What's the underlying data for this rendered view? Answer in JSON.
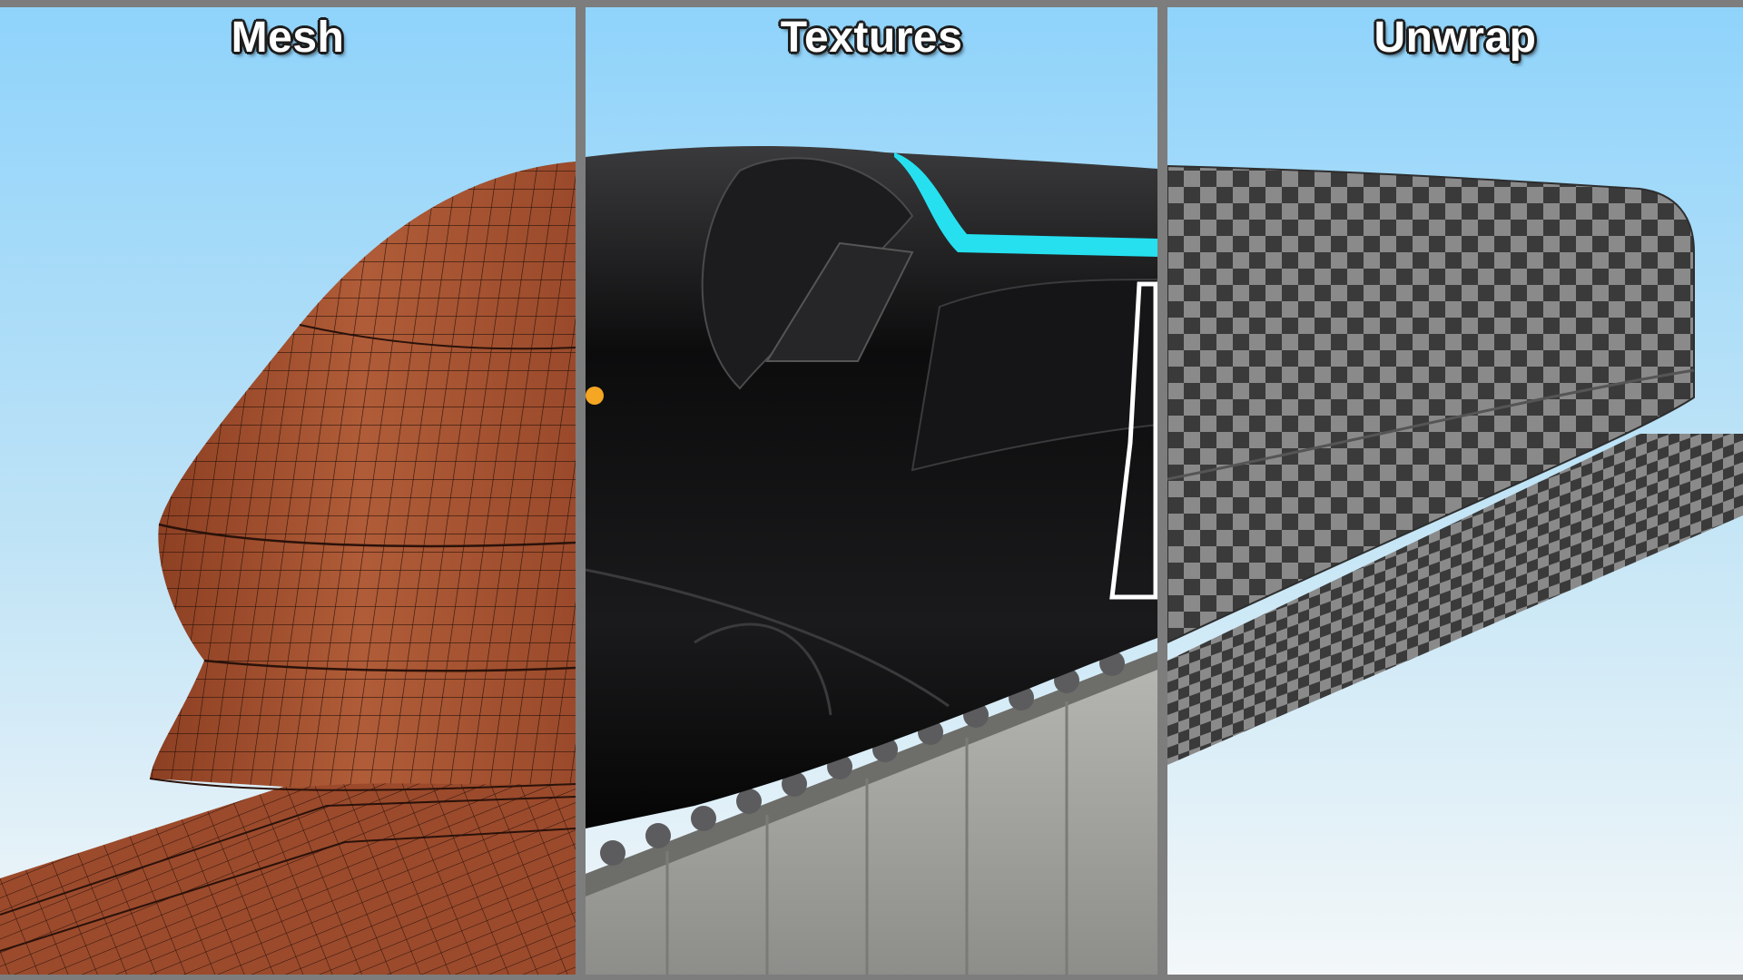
{
  "panels": [
    {
      "title": "Mesh"
    },
    {
      "title": "Textures"
    },
    {
      "title": "Unwrap"
    }
  ],
  "colors": {
    "frame": "#7d7d7d",
    "sky_top": "#8fd3fb",
    "sky_bottom": "#f4f8fa",
    "mesh_body": "#a24f2f",
    "mesh_wire": "#2a120a",
    "train_black": "#0b0b0c",
    "accent_cyan": "#26e0f0",
    "concrete": "#a6a6a3",
    "checker_dark": "#3a3a3a",
    "checker_light": "#8a8a8a"
  }
}
